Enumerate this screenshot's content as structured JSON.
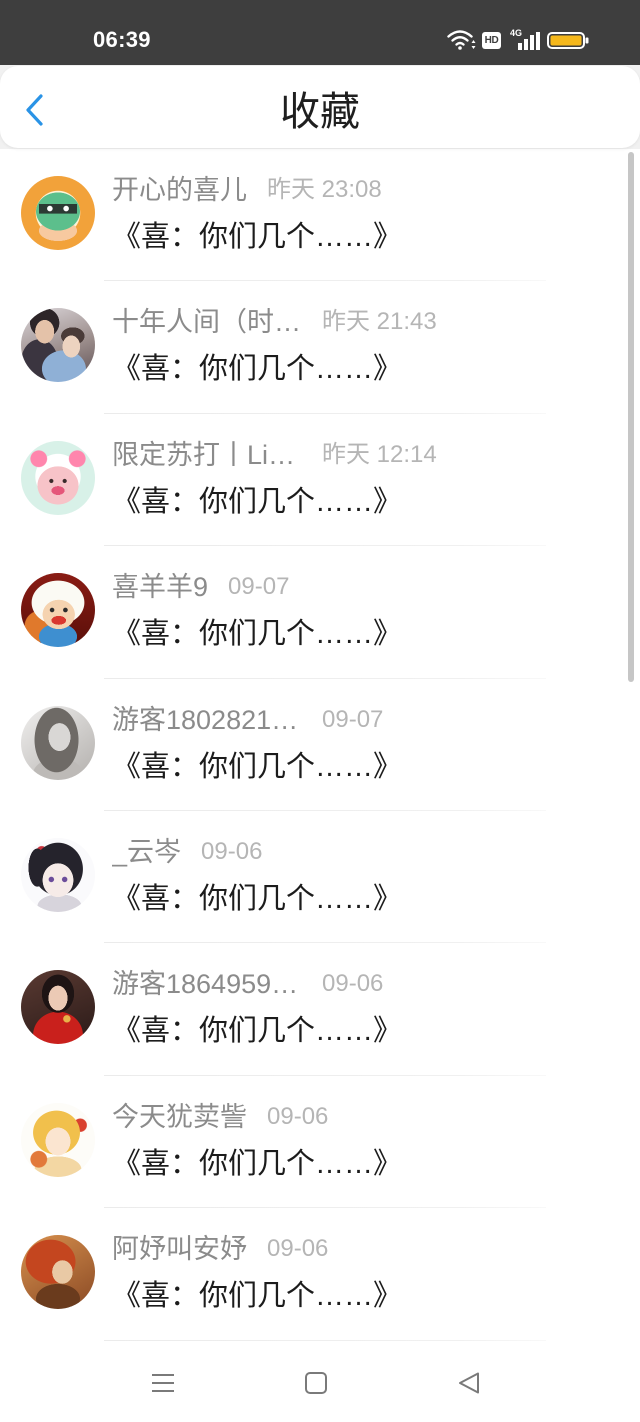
{
  "status_bar": {
    "time": "06:39",
    "hd_label": "HD",
    "network_label": "4G",
    "icons": [
      "wifi-icon",
      "signal-icon",
      "battery-icon"
    ],
    "battery_color": "#f5b81c"
  },
  "header": {
    "back_icon": "chevron-left-icon",
    "title": "收藏",
    "accent_color": "#2a93e6"
  },
  "favorites": [
    {
      "name": "开心的喜儿",
      "time": "昨天 23:08",
      "message": "《喜：你们几个……》"
    },
    {
      "name": "十年人间（时…",
      "time": "昨天 21:43",
      "message": "《喜：你们几个……》"
    },
    {
      "name": "限定苏打丨Li…",
      "time": "昨天 12:14",
      "message": "《喜：你们几个……》"
    },
    {
      "name": "喜羊羊9",
      "time": "09-07",
      "message": "《喜：你们几个……》"
    },
    {
      "name": "游客1802821…",
      "time": "09-07",
      "message": "《喜：你们几个……》"
    },
    {
      "name": "_云岑",
      "time": "09-06",
      "message": "《喜：你们几个……》"
    },
    {
      "name": "游客1864959…",
      "time": "09-06",
      "message": "《喜：你们几个……》"
    },
    {
      "name": "今天犹荬訾",
      "time": "09-06",
      "message": "《喜：你们几个……》"
    },
    {
      "name": "阿妤叫安妤",
      "time": "09-06",
      "message": "《喜：你们几个……》"
    }
  ],
  "nav_bar": {
    "icons": [
      "menu-icon",
      "home-square-icon",
      "back-triangle-icon"
    ]
  }
}
